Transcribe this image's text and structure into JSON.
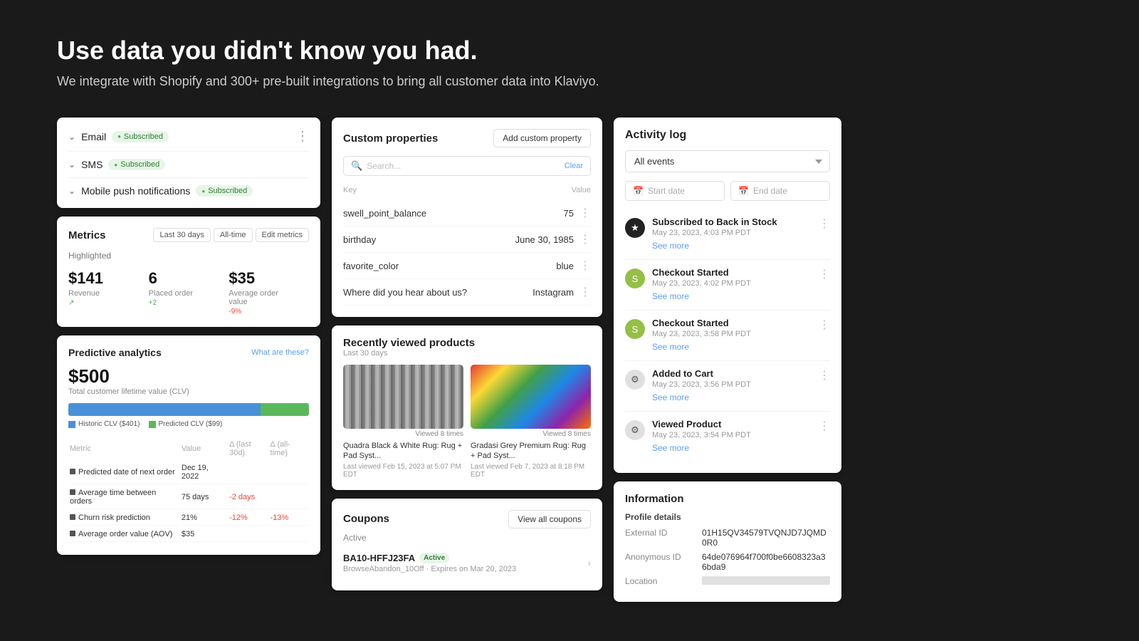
{
  "hero": {
    "title": "Use data you didn't know you had.",
    "subtitle": "We integrate with Shopify and 300+ pre-built integrations to bring all customer data into Klaviyo."
  },
  "subscriptions": {
    "items": [
      {
        "label": "Email",
        "status": "Subscribed"
      },
      {
        "label": "SMS",
        "status": "Subscribed"
      },
      {
        "label": "Mobile push notifications",
        "status": "Subscribed"
      }
    ]
  },
  "metrics": {
    "title": "Metrics",
    "highlighted_label": "Highlighted",
    "buttons": [
      "Last 30 days",
      "All-time",
      "Edit metrics"
    ],
    "values": [
      {
        "value": "$141",
        "label": "Revenue",
        "trend": ""
      },
      {
        "value": "6",
        "label": "Placed order",
        "trend": "+2"
      },
      {
        "value": "$35",
        "label": "Average order value",
        "trend": "-9%"
      }
    ]
  },
  "predictive_analytics": {
    "title": "Predictive analytics",
    "what_are_label": "What are these?",
    "clv_value": "$500",
    "clv_label": "Total customer lifetime value (CLV)",
    "legend": [
      {
        "label": "Historic CLV ($401)",
        "color": "blue"
      },
      {
        "label": "Predicted CLV ($99)",
        "color": "green"
      }
    ],
    "bar_blue_pct": 80,
    "bar_green_pct": 20,
    "table_headers": [
      "Metric",
      "Value",
      "Δ (last 30d)",
      "Δ (all-time)"
    ],
    "rows": [
      {
        "label": "Predicted date of next order",
        "value": "Dec 19, 2022",
        "d30": "",
        "dall": ""
      },
      {
        "label": "Average time between orders",
        "value": "75 days",
        "d30": "-2 days",
        "dall": ""
      },
      {
        "label": "Churn risk prediction",
        "value": "21%",
        "d30": "-12%",
        "dall": "-13%"
      },
      {
        "label": "Average order value (AOV)",
        "value": "$35",
        "d30": "",
        "dall": ""
      }
    ]
  },
  "custom_properties": {
    "title": "Custom properties",
    "add_button": "Add custom property",
    "search_placeholder": "Search...",
    "clear_label": "Clear",
    "col_key": "Key",
    "col_value": "Value",
    "rows": [
      {
        "key": "swell_point_balance",
        "value": "75"
      },
      {
        "key": "birthday",
        "value": "June 30, 1985"
      },
      {
        "key": "favorite_color",
        "value": "blue"
      },
      {
        "key": "Where did you hear about us?",
        "value": "Instagram"
      }
    ]
  },
  "recently_viewed": {
    "title": "Recently viewed products",
    "subtitle": "Last 30 days",
    "products": [
      {
        "name": "Quadra Black & White Rug: Rug + Pad Syst...",
        "views": "Viewed 8 times",
        "last_viewed": "Last viewed Feb 15, 2023 at 5:07 PM EDT",
        "thumb_type": "rug1"
      },
      {
        "name": "Gradasi Grey Premium Rug: Rug + Pad Syst...",
        "views": "Viewed 8 times",
        "last_viewed": "Last viewed Feb 7, 2023 at 8:18 PM EDT",
        "thumb_type": "rug2"
      }
    ]
  },
  "coupons": {
    "title": "Coupons",
    "view_all_button": "View all coupons",
    "active_label": "Active",
    "items": [
      {
        "code": "BA10-HFFJ23FA",
        "status": "Active",
        "detail": "BrowseAbandon_10Off · Expires on Mar 20, 2023"
      }
    ]
  },
  "activity_log": {
    "title": "Activity log",
    "filter_label": "All events",
    "start_date_placeholder": "Start date",
    "end_date_placeholder": "End date",
    "events": [
      {
        "title": "Subscribed to Back in Stock",
        "time": "May 23, 2023, 4:03 PM PDT",
        "see_more": "See more",
        "icon_type": "black",
        "icon": "★"
      },
      {
        "title": "Checkout Started",
        "time": "May 23, 2023, 4:02 PM PDT",
        "see_more": "See more",
        "icon_type": "shopify",
        "icon": "S"
      },
      {
        "title": "Checkout Started",
        "time": "May 23, 2023, 3:58 PM PDT",
        "see_more": "See more",
        "icon_type": "shopify",
        "icon": "S"
      },
      {
        "title": "Added to Cart",
        "time": "May 23, 2023, 3:56 PM PDT",
        "see_more": "See more",
        "icon_type": "gear",
        "icon": "⚙"
      },
      {
        "title": "Viewed Product",
        "time": "May 23, 2023, 3:54 PM PDT",
        "see_more": "See more",
        "icon_type": "gear",
        "icon": "⚙"
      }
    ]
  },
  "information": {
    "title": "Information",
    "section_label": "Profile details",
    "rows": [
      {
        "key": "External ID",
        "value": "01H15QV34579TVQNJD7JQMD0R0"
      },
      {
        "key": "Anonymous ID",
        "value": "64de076964f700f0be6608323a36bda9"
      },
      {
        "key": "Location",
        "value": ""
      }
    ]
  }
}
